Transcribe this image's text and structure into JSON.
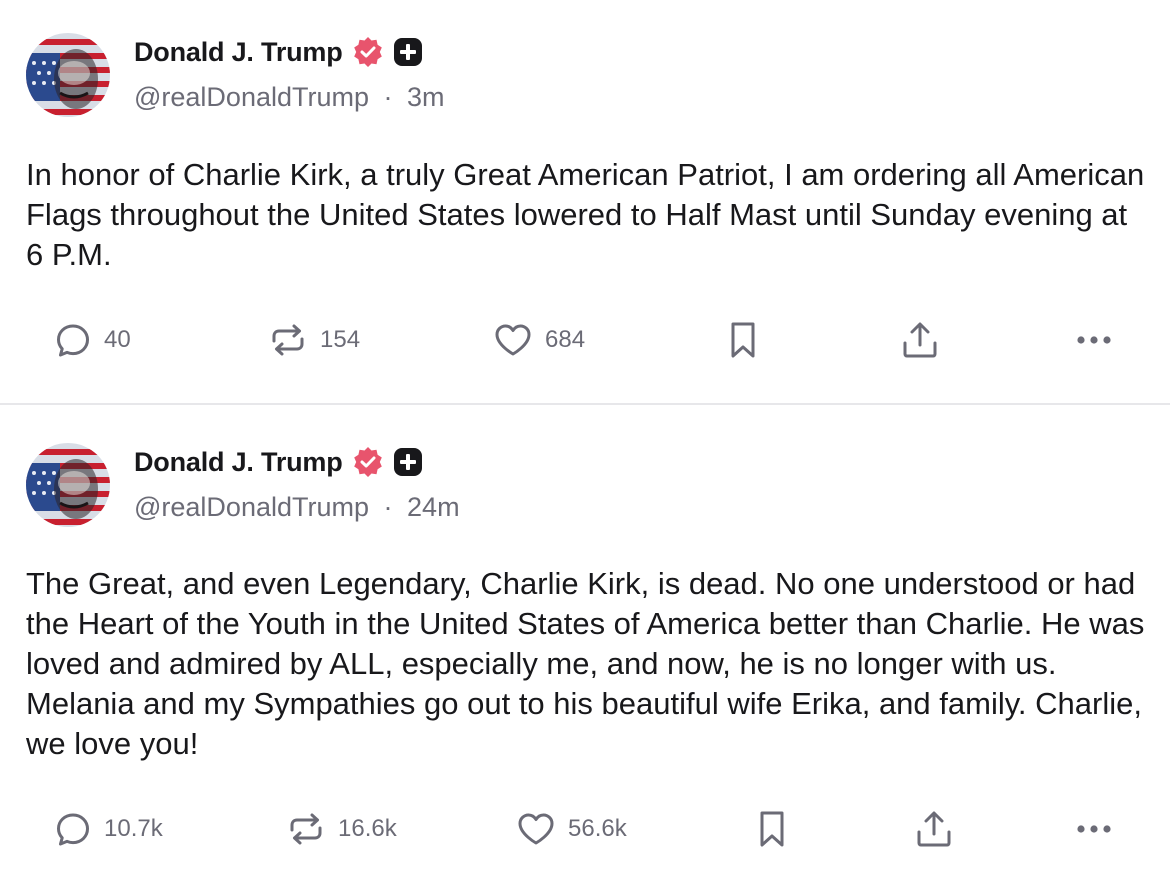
{
  "colors": {
    "text": "#18181b",
    "muted": "#6b6b76",
    "verified": "#e8546d",
    "divider": "#e7e7ea"
  },
  "posts": [
    {
      "author_name": "Donald J. Trump",
      "handle": "@realDonaldTrump",
      "separator": "·",
      "time": "3m",
      "text": "In honor of Charlie Kirk, a truly Great American Patriot, I am ordering all American Flags throughout the United States lowered to Half Mast until Sunday evening at 6 P.M.",
      "replies": "40",
      "reposts": "154",
      "likes": "684",
      "icons": [
        "verified-badge-icon",
        "plus-badge-icon",
        "reply-icon",
        "repost-icon",
        "heart-icon",
        "bookmark-icon",
        "share-icon",
        "more-icon"
      ]
    },
    {
      "author_name": "Donald J. Trump",
      "handle": "@realDonaldTrump",
      "separator": "·",
      "time": "24m",
      "text": "The Great, and even Legendary, Charlie Kirk, is dead. No one understood or had the Heart of the Youth in the United States of America better than Charlie. He was loved and admired by ALL, especially me, and now, he is no longer with us. Melania and my Sympathies go out to his beautiful wife Erika, and family. Charlie, we love you!",
      "replies": "10.7k",
      "reposts": "16.6k",
      "likes": "56.6k",
      "icons": [
        "verified-badge-icon",
        "plus-badge-icon",
        "reply-icon",
        "repost-icon",
        "heart-icon",
        "bookmark-icon",
        "share-icon",
        "more-icon"
      ]
    }
  ]
}
